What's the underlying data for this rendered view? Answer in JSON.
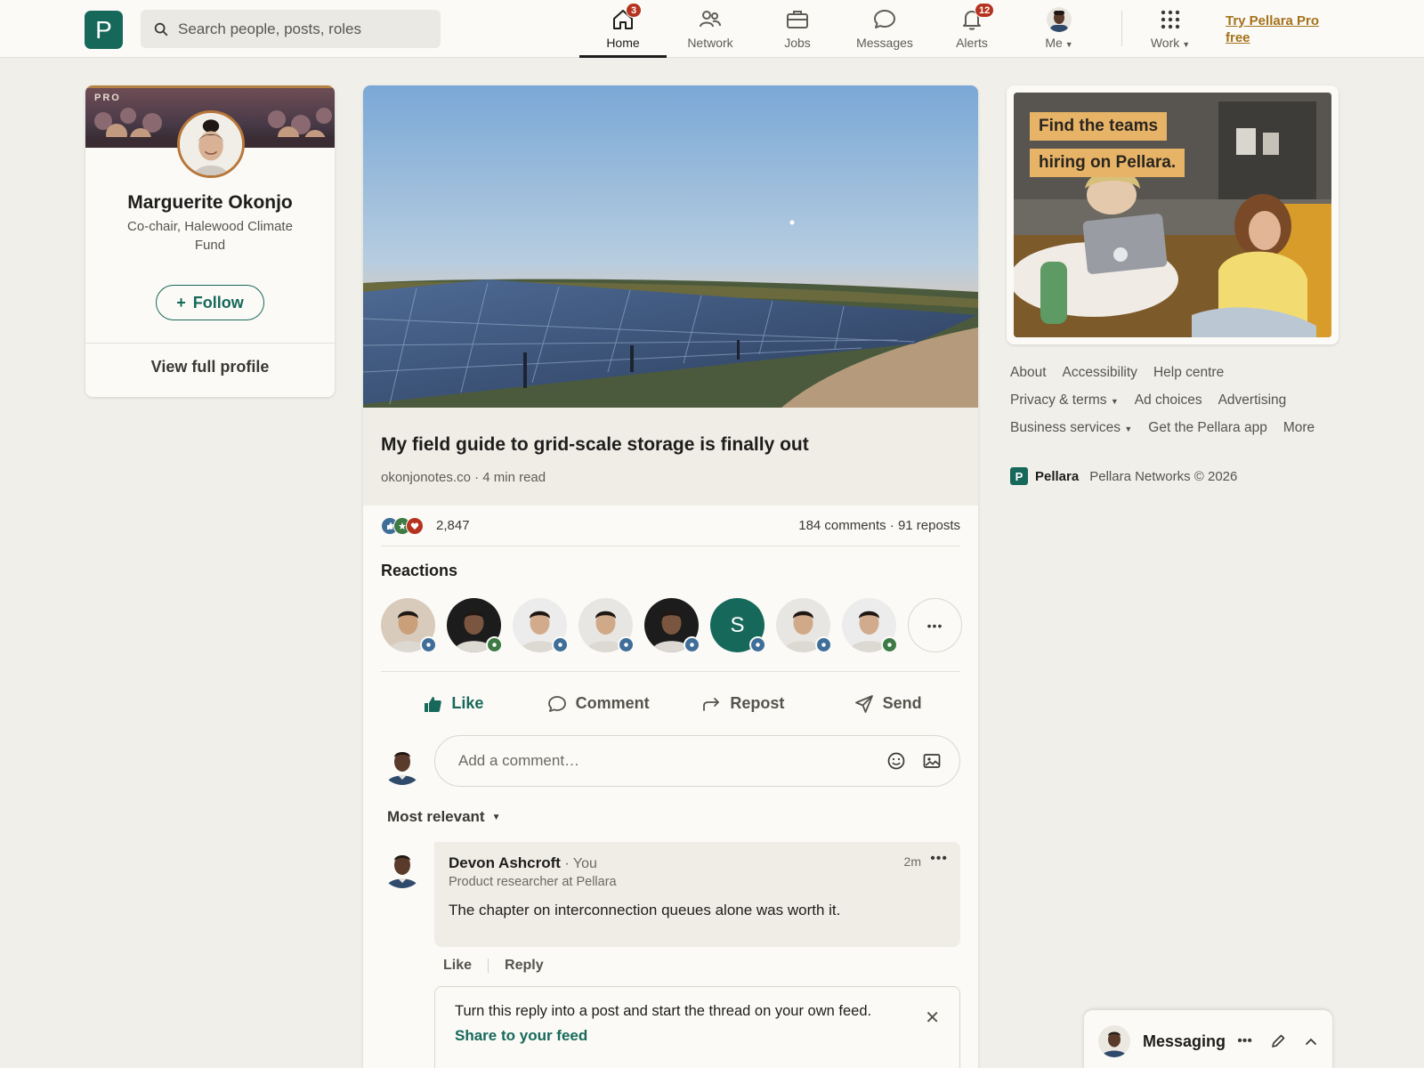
{
  "brand": {
    "logo_letter": "P",
    "name": "Pellara",
    "copyright": "Pellara Networks © 2026"
  },
  "search": {
    "placeholder": "Search people, posts, roles"
  },
  "nav": {
    "items": [
      {
        "label": "Home",
        "icon": "home-icon",
        "badge": "3",
        "active": true
      },
      {
        "label": "Network",
        "icon": "network-icon"
      },
      {
        "label": "Jobs",
        "icon": "briefcase-icon"
      },
      {
        "label": "Messages",
        "icon": "chat-icon"
      },
      {
        "label": "Alerts",
        "icon": "bell-icon",
        "badge": "12"
      },
      {
        "label": "Me",
        "icon": "avatar"
      }
    ],
    "work_label": "Work",
    "pro_link": "Try Pellara Pro free"
  },
  "profile": {
    "banner_tag": "PRO",
    "name": "Marguerite Okonjo",
    "role": "Co-chair, Halewood Climate Fund",
    "follow_label": "Follow",
    "view_profile_label": "View full profile"
  },
  "post": {
    "link_title": "My field guide to grid-scale storage is finally out",
    "link_meta": "okonjonotes.co · 4 min read",
    "reaction_count": "2,847",
    "comment_stats": "184 comments · 91 reposts",
    "reactions_title": "Reactions",
    "reactors": [
      {
        "initial": "",
        "tone": "#c9a07a",
        "bg": "#d9cbbb",
        "badge": "like"
      },
      {
        "initial": "",
        "tone": "#7a5640",
        "bg": "#1c1c1c",
        "badge": "celebrate"
      },
      {
        "initial": "",
        "tone": "#d2ab8d",
        "bg": "#ececec",
        "badge": "like"
      },
      {
        "initial": "",
        "tone": "#d0a988",
        "bg": "#e8e6e2",
        "badge": "like"
      },
      {
        "initial": "",
        "tone": "#7a5640",
        "bg": "#1c1c1c",
        "badge": "like"
      },
      {
        "initial": "S",
        "tone": "",
        "bg": "#16695a",
        "badge": "like"
      },
      {
        "initial": "",
        "tone": "#d0a988",
        "bg": "#e8e6e2",
        "badge": "like"
      },
      {
        "initial": "",
        "tone": "#d2ab8d",
        "bg": "#ececec",
        "badge": "celebrate"
      }
    ],
    "actions": {
      "like": "Like",
      "comment": "Comment",
      "repost": "Repost",
      "send": "Send"
    },
    "composer_placeholder": "Add a comment…",
    "sort_label": "Most relevant"
  },
  "comment": {
    "author": "Devon Ashcroft",
    "you_tag": "· You",
    "headline": "Product researcher at Pellara",
    "text": "The chapter on interconnection queues alone was worth it.",
    "time": "2m",
    "like_label": "Like",
    "reply_label": "Reply"
  },
  "tip": {
    "text": "Turn this reply into a post and start the thread on your own feed.",
    "link": "Share to your feed"
  },
  "ad": {
    "line1": "Find the teams",
    "line2": "hiring on Pellara."
  },
  "footer": {
    "rows": [
      [
        "About",
        "Accessibility",
        "Help centre"
      ],
      [
        "Privacy & terms",
        "Ad choices",
        "Advertising"
      ],
      [
        "Business services",
        "Get the Pellara app",
        "More"
      ]
    ]
  },
  "messaging": {
    "title": "Messaging"
  },
  "colors": {
    "brand": "#16695a",
    "accent": "#a4711a",
    "badge": "#b5341f",
    "background": "#f0efea"
  }
}
